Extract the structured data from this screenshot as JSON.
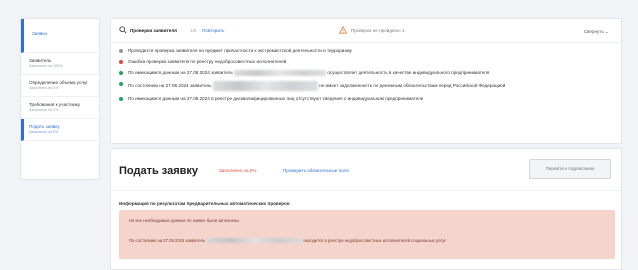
{
  "sidebar": {
    "top_label": "Заявка",
    "items": [
      {
        "title": "Заявитель",
        "sub": "Заполнено на 100%"
      },
      {
        "title": "Определение объема услуг",
        "sub": "Заполнено на 0%"
      },
      {
        "title": "Требования к участнику",
        "sub": "Заполнено на 0%"
      },
      {
        "title": "Подать заявку",
        "sub": "Заполнено на 0%"
      }
    ]
  },
  "check": {
    "title": "Проверки заявителя",
    "count": "1/5",
    "link": "Повторить",
    "warning": "Проверок не пройдено: 1",
    "collapse": "Свернуть",
    "rows": [
      {
        "status": "gray",
        "text": "Проводится проверка заявителя на предмет причастности к экстремистской деятельности и терроризму"
      },
      {
        "status": "red",
        "text": "Ошибка проверки заявителя по реестру недобросовестных исполнителей"
      },
      {
        "status": "green",
        "text_a": "По имеющимся данным на 27.08.2024 заявитель",
        "text_b": "осуществляет деятельность в качестве индивидуального предпринимателя"
      },
      {
        "status": "green",
        "text_a": "По состоянию на 27.08.2024 заявитель",
        "text_b": "не имеет задолженность по денежным обязательствам перед Российской Федерацией"
      },
      {
        "status": "green",
        "text": "По имеющимся данным на 27.08.2024 в реестре дисквалифицированных лиц отсутствуют сведения о индивидуальном предпринимателе"
      }
    ]
  },
  "apply": {
    "title": "Подать заявку",
    "filled": "Заполнено на 0%",
    "required_link": "Проверить обязательные поля",
    "button": "Перейти к подписанию",
    "sub_heading": "Информация по результатам предварительных автоматических проверок:",
    "error_line_1": "Не все необходимые данные по заявке были заполнены",
    "error_line_2_a": "По состоянию на 27.08.2024 заявитель",
    "error_line_2_b": "находится в реестре недобросовестных исполнителей социальных услуг"
  }
}
